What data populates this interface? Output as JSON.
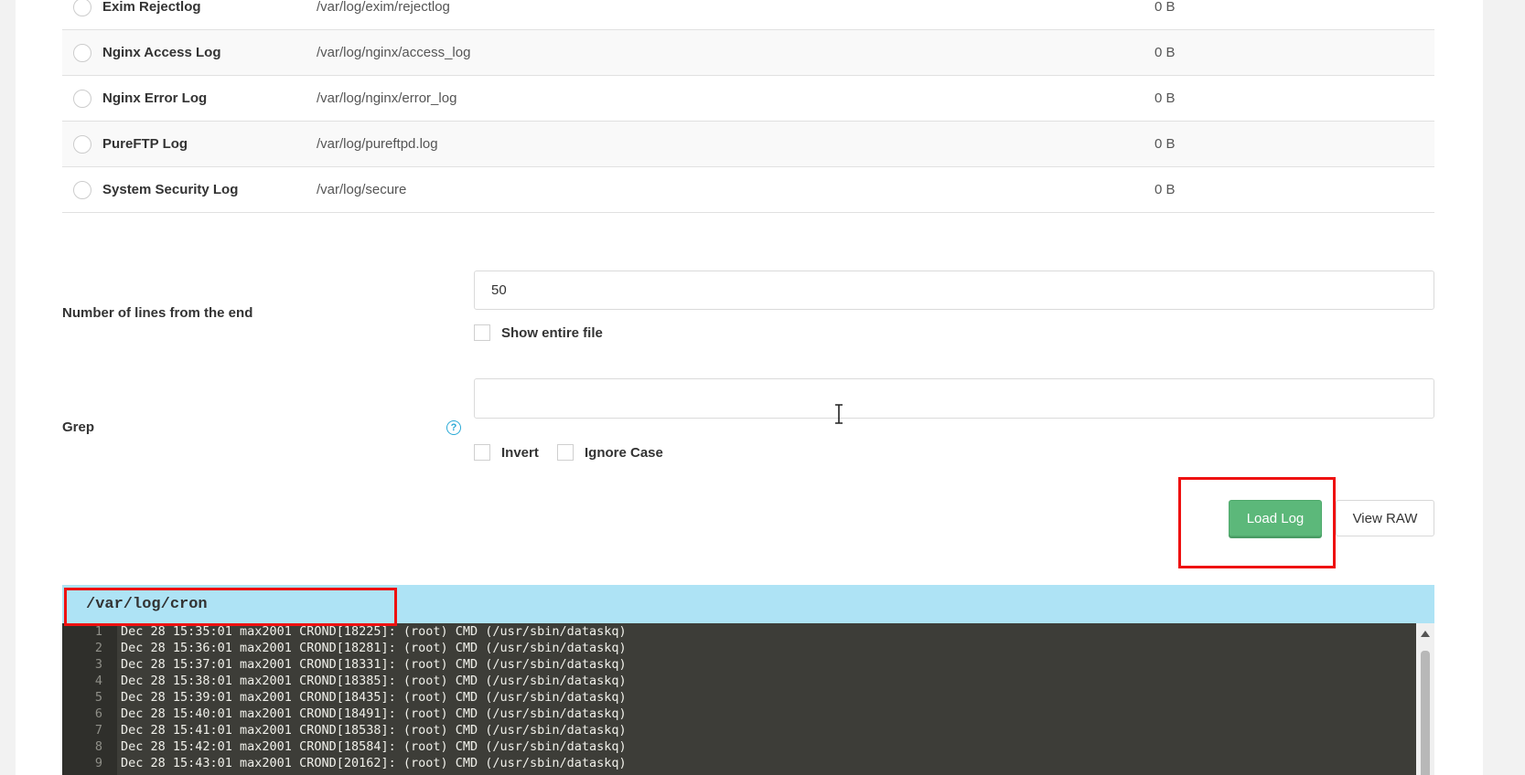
{
  "log_files": [
    {
      "name": "Exim Rejectlog",
      "path": "/var/log/exim/rejectlog",
      "size": "0 B"
    },
    {
      "name": "Nginx Access Log",
      "path": "/var/log/nginx/access_log",
      "size": "0 B"
    },
    {
      "name": "Nginx Error Log",
      "path": "/var/log/nginx/error_log",
      "size": "0 B"
    },
    {
      "name": "PureFTP Log",
      "path": "/var/log/pureftpd.log",
      "size": "0 B"
    },
    {
      "name": "System Security Log",
      "path": "/var/log/secure",
      "size": "0 B"
    }
  ],
  "form": {
    "lines_label": "Number of lines from the end",
    "lines_value": "50",
    "show_entire_file": "Show entire file",
    "grep_label": "Grep",
    "grep_value": "",
    "help_glyph": "?",
    "invert_label": "Invert",
    "ignore_case_label": "Ignore Case"
  },
  "buttons": {
    "load_log": "Load Log",
    "view_raw": "View RAW"
  },
  "output": {
    "title": "/var/log/cron",
    "lines": [
      {
        "n": "1",
        "text": "Dec 28 15:35:01 max2001 CROND[18225]: (root) CMD (/usr/sbin/dataskq)"
      },
      {
        "n": "2",
        "text": "Dec 28 15:36:01 max2001 CROND[18281]: (root) CMD (/usr/sbin/dataskq)"
      },
      {
        "n": "3",
        "text": "Dec 28 15:37:01 max2001 CROND[18331]: (root) CMD (/usr/sbin/dataskq)"
      },
      {
        "n": "4",
        "text": "Dec 28 15:38:01 max2001 CROND[18385]: (root) CMD (/usr/sbin/dataskq)"
      },
      {
        "n": "5",
        "text": "Dec 28 15:39:01 max2001 CROND[18435]: (root) CMD (/usr/sbin/dataskq)"
      },
      {
        "n": "6",
        "text": "Dec 28 15:40:01 max2001 CROND[18491]: (root) CMD (/usr/sbin/dataskq)"
      },
      {
        "n": "7",
        "text": "Dec 28 15:41:01 max2001 CROND[18538]: (root) CMD (/usr/sbin/dataskq)"
      },
      {
        "n": "8",
        "text": "Dec 28 15:42:01 max2001 CROND[18584]: (root) CMD (/usr/sbin/dataskq)"
      },
      {
        "n": "9",
        "text": "Dec 28 15:43:01 max2001 CROND[20162]: (root) CMD (/usr/sbin/dataskq)"
      }
    ]
  },
  "colors": {
    "accent_green": "#5cb87a",
    "header_blue": "#aee3f5",
    "annotation_red": "#ee1111"
  }
}
